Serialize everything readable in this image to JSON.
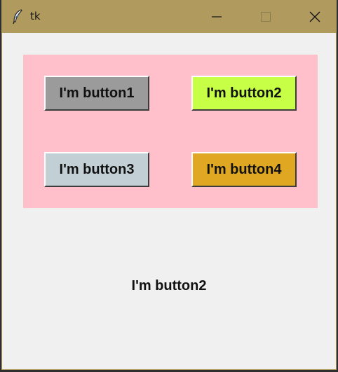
{
  "window": {
    "title": "tk",
    "titlebar_color": "#b09a5e",
    "background": "#f0f0f0",
    "icons": {
      "app": "feather-icon",
      "minimize": "minimize-icon",
      "maximize": "maximize-icon",
      "close": "close-icon"
    }
  },
  "panel": {
    "background": "#ffc0cb",
    "buttons": [
      {
        "label": "I'm button1",
        "color": "#9b9b9b"
      },
      {
        "label": "I'm button2",
        "color": "#c6ff45"
      },
      {
        "label": "I'm button3",
        "color": "#c2d0d6"
      },
      {
        "label": "I'm button4",
        "color": "#e0a722"
      }
    ]
  },
  "status_label": "I'm button2"
}
